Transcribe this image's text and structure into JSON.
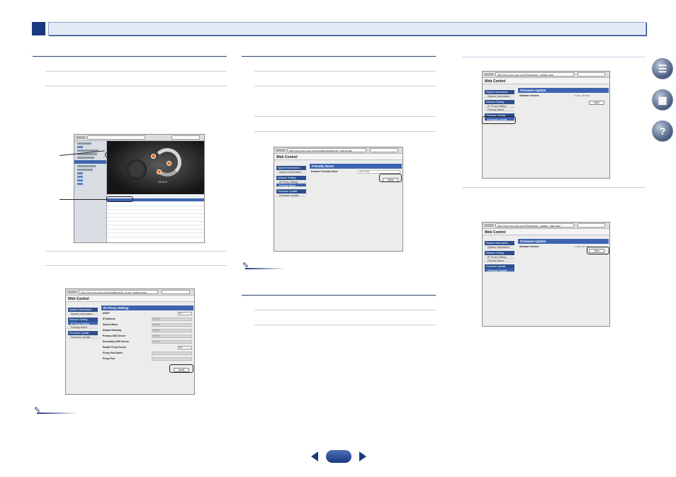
{
  "colors": {
    "accent": "#1a3a80",
    "highlight": "#3d64b0",
    "panel": "#ececec"
  },
  "side_icons": [
    "book-icon",
    "remote-control-icon",
    "help-icon"
  ],
  "app_window": {
    "sidebar_items": 12,
    "stage_tag": "DEVICE",
    "list_rows": [
      "",
      "",
      "",
      "",
      "",
      "",
      "",
      "",
      "",
      "",
      "",
      ""
    ]
  },
  "proxy_window": {
    "url": "http://xxx.xxx.xxx.xxx/1/settings/ip_proxy_setting.asp",
    "brand": "Web Control",
    "nav": {
      "g1": "System Information",
      "g1_i1": "System Information",
      "g2": "Network Setting",
      "g2_i1": "IP, Proxy Setting",
      "g2_i2": "Friendly Name",
      "g3": "Firmware Update",
      "g3_i1": "Firmware Update"
    },
    "title": "IP, Proxy Setting",
    "rows": {
      "r1": "DHCP",
      "r1_val": "On",
      "r2": "IP Address",
      "r2_val": "0.0.0.0",
      "r3": "Subnet Mask",
      "r3_val": "0.0.0.0",
      "r4": "Default Gateway",
      "r4_val": "0.0.0.0",
      "r5": "Primary DNS Server",
      "r5_val": "0.0.0.0",
      "r6": "Secondary DNS Server",
      "r6_val": "0.0.0.0",
      "r7": "Enable Proxy Server",
      "r7_val": "Off",
      "r8": "Proxy Host Name",
      "r9": "Proxy Port"
    },
    "apply": "Apply"
  },
  "friendly_window": {
    "url": "http://xxx.xxx.xxx.xxx/1/settings/friendly_name.asp",
    "brand": "Web Control",
    "title": "Friendly Name",
    "row": "Rename Friendly Name",
    "row_val": "VSX-S500",
    "apply": "Apply"
  },
  "fw1_window": {
    "url": "http://xxx.xxx.xxx.xxx/1/firmware_update.asp",
    "brand": "Web Control",
    "title": "Firmware Update",
    "row": "Software Version",
    "row_val": "x.xxx_xxx.xxx",
    "btn": "Start"
  },
  "fw2_window": {
    "url": "http://xxx.xxx.xxx.xxx/1/firmware_update_start.asp",
    "brand": "Web Control",
    "title": "Firmware Update",
    "row": "Software Version",
    "row_val": "x.xxx_xxx.xxx",
    "btn": "Start"
  }
}
